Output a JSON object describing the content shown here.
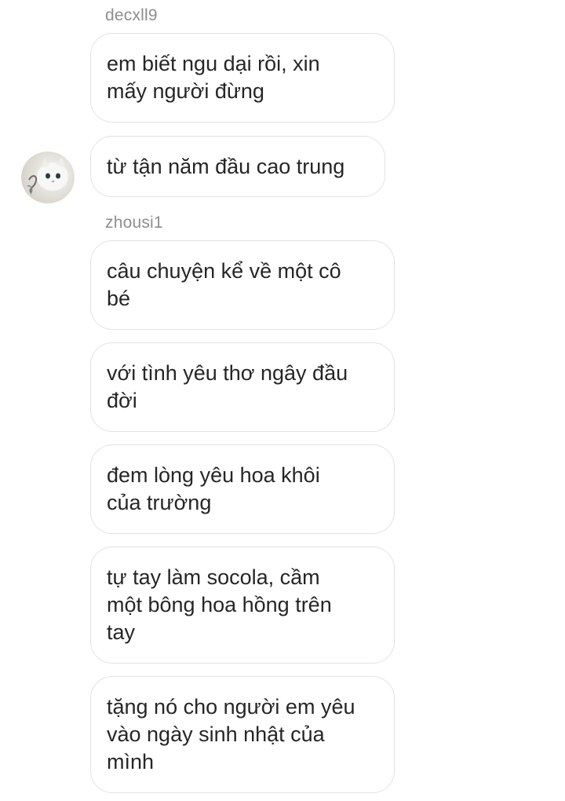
{
  "conversation": {
    "groups": [
      {
        "sender": "decxll9",
        "messages": [
          "em biết ngu dại rồi, xin\nmấy người đừng",
          "từ tận năm đầu cao trung"
        ]
      },
      {
        "sender": "zhousi1",
        "messages": [
          "câu chuyện kể về một cô\nbé",
          "với tình yêu thơ ngây đầu\nđời",
          "đem lòng yêu hoa khôi\ncủa trường",
          "tự tay làm socola, cầm\nmột bông hoa hồng trên\ntay",
          "tặng nó cho người em yêu\nvào ngày sinh nhật của\nmình"
        ]
      }
    ]
  }
}
